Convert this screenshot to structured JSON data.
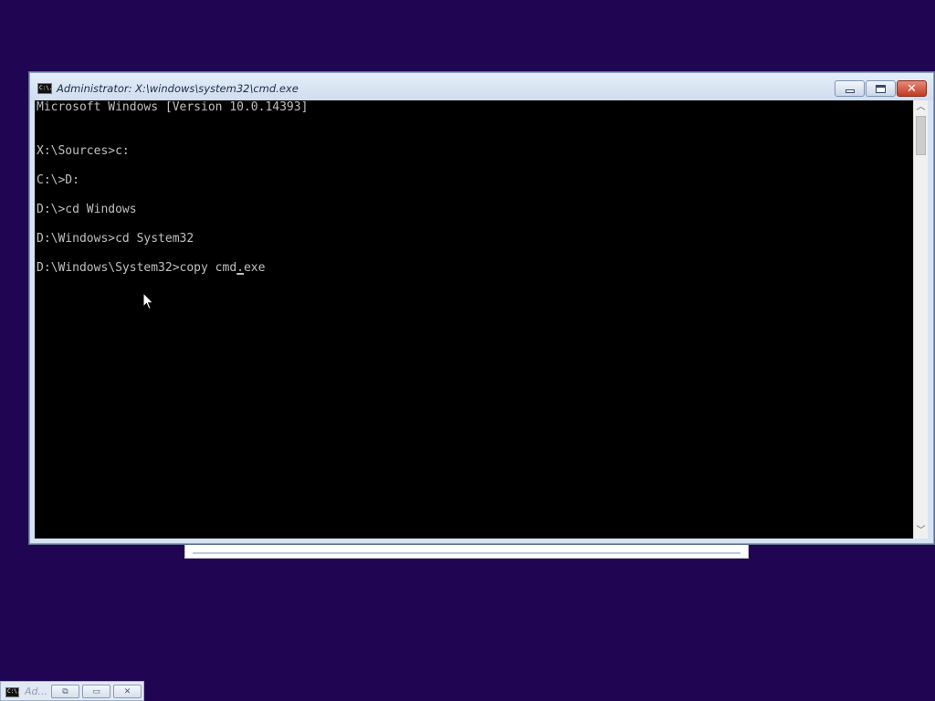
{
  "window": {
    "title": "Administrator: X:\\windows\\system32\\cmd.exe",
    "icon": "console-icon",
    "icon_text": "C:\\.",
    "controls": {
      "minimize_glyph": "",
      "maximize_glyph": "",
      "close_glyph": "✕"
    }
  },
  "console": {
    "lines": [
      "Microsoft Windows [Version 10.0.14393]",
      "",
      "",
      "X:\\Sources>c:",
      "",
      "C:\\>D:",
      "",
      "D:\\>cd Windows",
      "",
      "D:\\Windows>cd System32",
      "",
      "D:\\Windows\\System32>copy cmd"
    ],
    "input_before_cursor": "D:\\Windows\\System32>copy cmd",
    "input_cursor_char": ".",
    "input_after_cursor": "exe",
    "background": "#000000",
    "foreground": "#c0c0c0"
  },
  "scrollbar": {
    "up_glyph": "︿",
    "down_glyph": "﹀"
  },
  "minimized_window": {
    "title": "Ad...",
    "icon_text": "C:\\.",
    "restore_glyph": "⧉",
    "maximize_glyph": "▭",
    "close_glyph": "✕"
  },
  "colors": {
    "desktop": "#1f0552",
    "titlebar": "#d6e3f3",
    "close_button": "#c7432c"
  }
}
